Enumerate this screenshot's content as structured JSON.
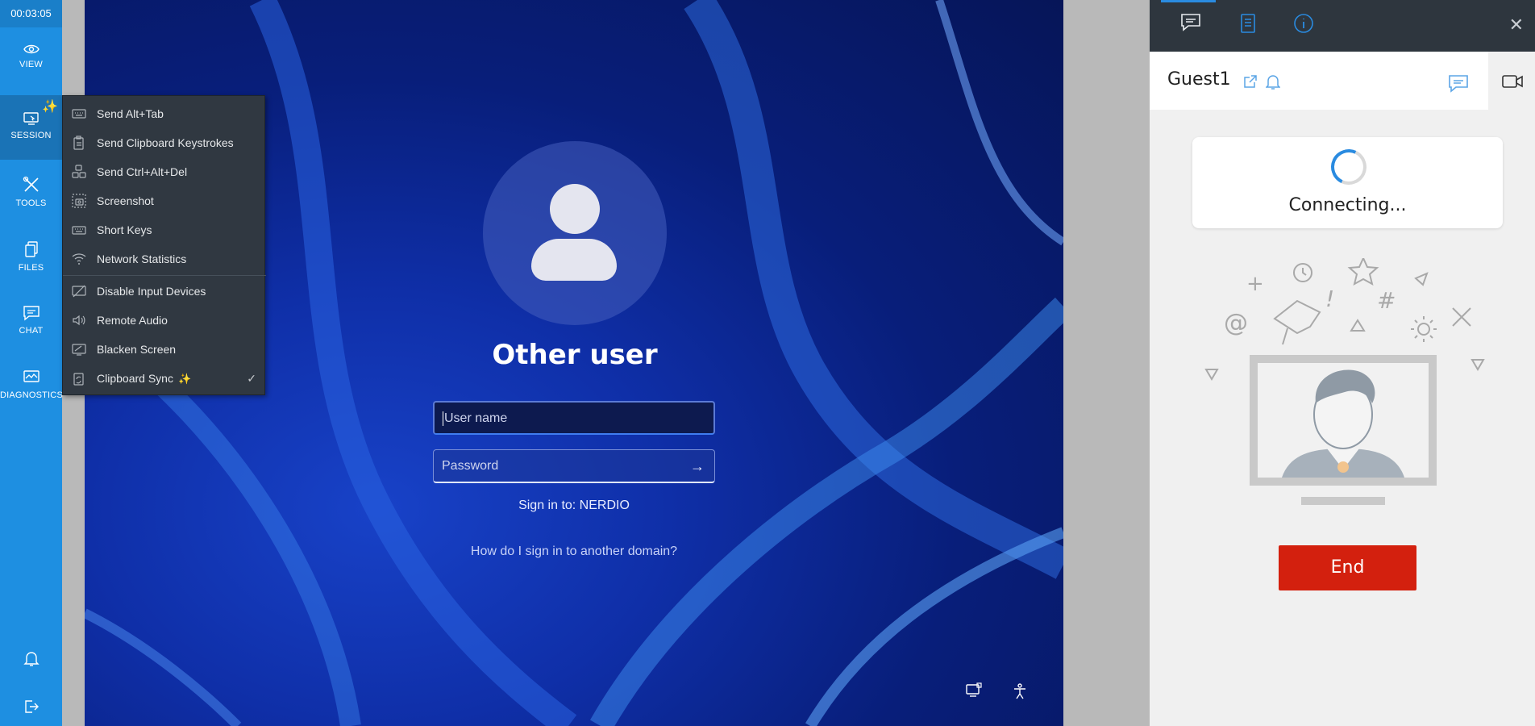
{
  "sidebar": {
    "timer": "00:03:05",
    "items": [
      {
        "label": "VIEW"
      },
      {
        "label": "SESSION"
      },
      {
        "label": "TOOLS"
      },
      {
        "label": "FILES"
      },
      {
        "label": "CHAT"
      },
      {
        "label": "DIAGNOSTICS"
      }
    ],
    "bottom_icons": [
      "bell-icon",
      "logout-icon"
    ],
    "accent": "#1e8fe1"
  },
  "session_menu": {
    "items": [
      {
        "label": "Send Alt+Tab",
        "icon": "keyboard-icon"
      },
      {
        "label": "Send Clipboard Keystrokes",
        "icon": "clipboard-icon"
      },
      {
        "label": "Send Ctrl+Alt+Del",
        "icon": "keys-icon"
      },
      {
        "label": "Screenshot",
        "icon": "camera-icon"
      },
      {
        "label": "Short Keys",
        "icon": "keyboard-icon"
      },
      {
        "label": "Network Statistics",
        "icon": "wifi-icon"
      },
      {
        "label": "Disable Input Devices",
        "icon": "no-input-icon"
      },
      {
        "label": "Remote Audio",
        "icon": "speaker-icon"
      },
      {
        "label": "Blacken Screen",
        "icon": "screen-icon"
      },
      {
        "label": "Clipboard Sync",
        "icon": "sync-icon",
        "checked": true
      }
    ]
  },
  "remote": {
    "user_title": "Other user",
    "username_placeholder": "User name",
    "password_placeholder": "Password",
    "sign_in_to": "Sign in to: NERDIO",
    "domain_link": "How do I sign in to another domain?",
    "bottom_icons": [
      "network-icon",
      "accessibility-icon"
    ]
  },
  "panel": {
    "tabs": [
      "chat-icon",
      "document-icon",
      "info-icon"
    ],
    "guest_name": "Guest1",
    "status": "Connecting...",
    "end_label": "End",
    "end_color": "#d3200e"
  }
}
